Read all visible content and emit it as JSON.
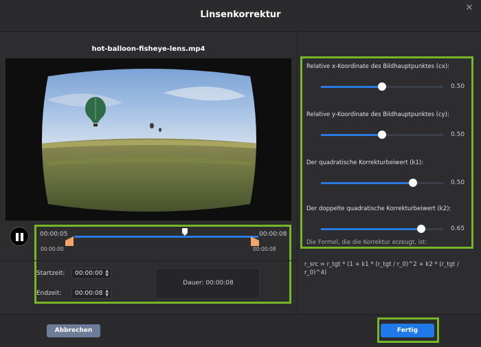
{
  "window": {
    "title": "Linsenkorrektur",
    "close_icon": "close-icon"
  },
  "video": {
    "filename": "hot-balloon-fisheye-lens.mp4"
  },
  "timeline": {
    "current_start": "00:00:05",
    "current_end": "00:00:08",
    "range_start": "00:00:00",
    "range_end": "00:00:08"
  },
  "trim": {
    "start_label": "Startzeit:",
    "start_value": "00:00:00",
    "end_label": "Endzeit:",
    "end_value": "00:00:08",
    "duration_text": "Dauer:  00:00:08"
  },
  "params": [
    {
      "label": "Relative x-Koordinate des Bildhauptpunktes (cx):",
      "value": "0.50",
      "fraction": 0.5
    },
    {
      "label": "Relative y-Koordinate des Bildhauptpunktes (cy):",
      "value": "0.50",
      "fraction": 0.5
    },
    {
      "label": "Der quadratische Korrekturbeiwert (k1):",
      "value": "0.50",
      "fraction": 0.75
    },
    {
      "label": "Der doppelte quadratische Korrekturbeiwert (k2):",
      "value": "0.65",
      "fraction": 0.82
    }
  ],
  "formula": {
    "label": "Die Formel, die die Korrektur erzeugt, ist:",
    "text": "r_src = r_tgt * (1 + k1 * (r_tgt / r_0)^2 + k2 * (r_tgt / r_0)^4)"
  },
  "footer": {
    "cancel_label": "Abbrechen",
    "done_label": "Fertig"
  },
  "colors": {
    "accent": "#2a7ae2",
    "highlight": "#76b72a",
    "trim_handle": "#f5a46a"
  }
}
